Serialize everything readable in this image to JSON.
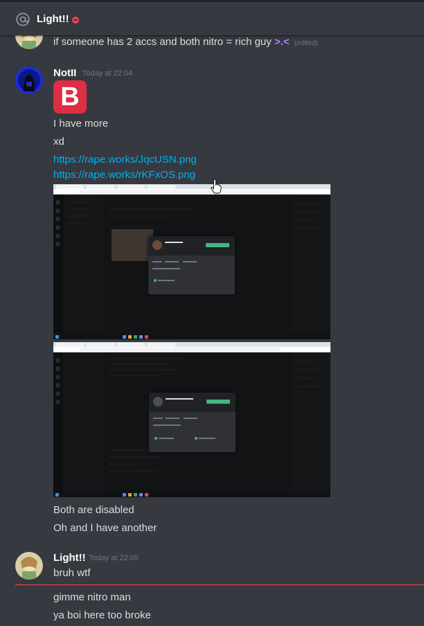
{
  "header": {
    "channel_name": "Light!!",
    "at_icon": "at-icon",
    "status": "do-not-disturb"
  },
  "messages": [
    {
      "author": "",
      "text": "if someone has 2 accs  and both nitro = rich guy",
      "emote": ">.<",
      "edited": "(edited)"
    },
    {
      "author": "NotII",
      "timestamp": "Today at 22:04",
      "emoji_letter": "B",
      "lines": [
        "I have more",
        "xd"
      ],
      "links": [
        "https://rape.works/JqcUSN.png",
        "https://rape.works/rKFxOS.png"
      ],
      "after_lines": [
        "Both are disabled",
        "Oh and I have another"
      ]
    },
    {
      "author": "Light!!",
      "timestamp": "Today at 22:05",
      "lines": [
        "bruh wtf"
      ],
      "after_divider": [
        "gimme nitro man",
        "ya boi here too broke"
      ]
    }
  ],
  "colors": {
    "background": "#36393f",
    "link": "#00b0f4",
    "username": "#ffffff",
    "timestamp": "#72767d",
    "new_divider": "#f04747",
    "emote": "#b980ff"
  }
}
